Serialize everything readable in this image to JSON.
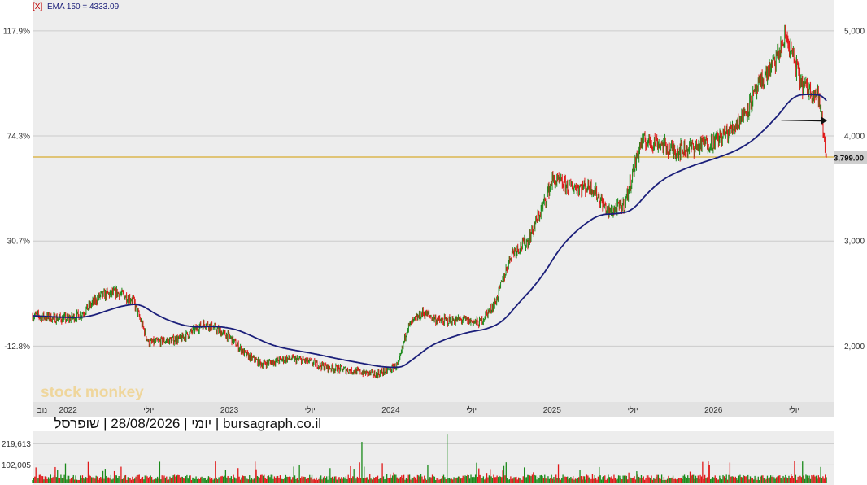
{
  "legend": {
    "close_marker": "[X]",
    "ema_label": "EMA 150 = 4333.09"
  },
  "footer_text": "יומי | 28/08/2026 | שופרסל | bursagraph.co.il",
  "watermark": "stock monkey",
  "last_price_label": "3,799.00",
  "colors": {
    "up": "#1a8a1a",
    "down": "#e01818",
    "ema": "#1b1f7a",
    "ref": "#d49a00",
    "bg": "#ededed"
  },
  "chart_data": {
    "type": "candlestick",
    "left_axis": {
      "ticks": [
        "117.9%",
        "74.3%",
        "30.7%",
        "-12.8%"
      ],
      "values": [
        5000,
        4000,
        3000,
        2000
      ]
    },
    "right_axis": {
      "ticks": [
        "5,000",
        "4,000",
        "3,000",
        "2,000"
      ],
      "values": [
        5000,
        4000,
        3000,
        2000
      ]
    },
    "ylim": [
      1500,
      5200
    ],
    "x_labels": [
      "נוב",
      "2022",
      "יולי",
      "2023",
      "יולי",
      "2024",
      "יולי",
      "2025",
      "יולי",
      "2026",
      "יולי"
    ],
    "x_label_positions": [
      2021.84,
      2022.0,
      2022.5,
      2023.0,
      2023.5,
      2024.0,
      2024.5,
      2025.0,
      2025.5,
      2026.0,
      2026.5
    ],
    "xlim": [
      2021.78,
      2026.75
    ],
    "price_path": {
      "t": [
        2021.78,
        2021.9,
        2022.0,
        2022.08,
        2022.2,
        2022.3,
        2022.4,
        2022.5,
        2022.7,
        2022.85,
        2023.0,
        2023.1,
        2023.2,
        2023.35,
        2023.45,
        2023.6,
        2023.75,
        2023.9,
        2024.0,
        2024.05,
        2024.1,
        2024.2,
        2024.3,
        2024.45,
        2024.55,
        2024.65,
        2024.75,
        2024.85,
        2024.95,
        2025.0,
        2025.1,
        2025.25,
        2025.35,
        2025.45,
        2025.55,
        2025.65,
        2025.75,
        2025.9,
        2026.0,
        2026.1,
        2026.2,
        2026.3,
        2026.38,
        2026.45,
        2026.55,
        2026.65,
        2026.7
      ],
      "close": [
        2290,
        2270,
        2260,
        2300,
        2480,
        2510,
        2450,
        2030,
        2070,
        2220,
        2090,
        1920,
        1830,
        1880,
        1870,
        1800,
        1770,
        1730,
        1780,
        1830,
        2170,
        2320,
        2240,
        2250,
        2220,
        2420,
        2890,
        3000,
        3360,
        3580,
        3520,
        3510,
        3270,
        3350,
        3940,
        3940,
        3860,
        3900,
        3950,
        4040,
        4230,
        4520,
        4700,
        4950,
        4480,
        4390,
        3799
      ]
    },
    "ema_label": "EMA 150 = 4333.09",
    "ema_last_value": 4333.09,
    "last_price": 3799.0,
    "reference_price": 3799.0,
    "arrow_level": 4150,
    "volume": {
      "ticks": [
        "219,613",
        "102,005"
      ],
      "values": [
        219613,
        102005
      ],
      "max": 280000
    }
  }
}
